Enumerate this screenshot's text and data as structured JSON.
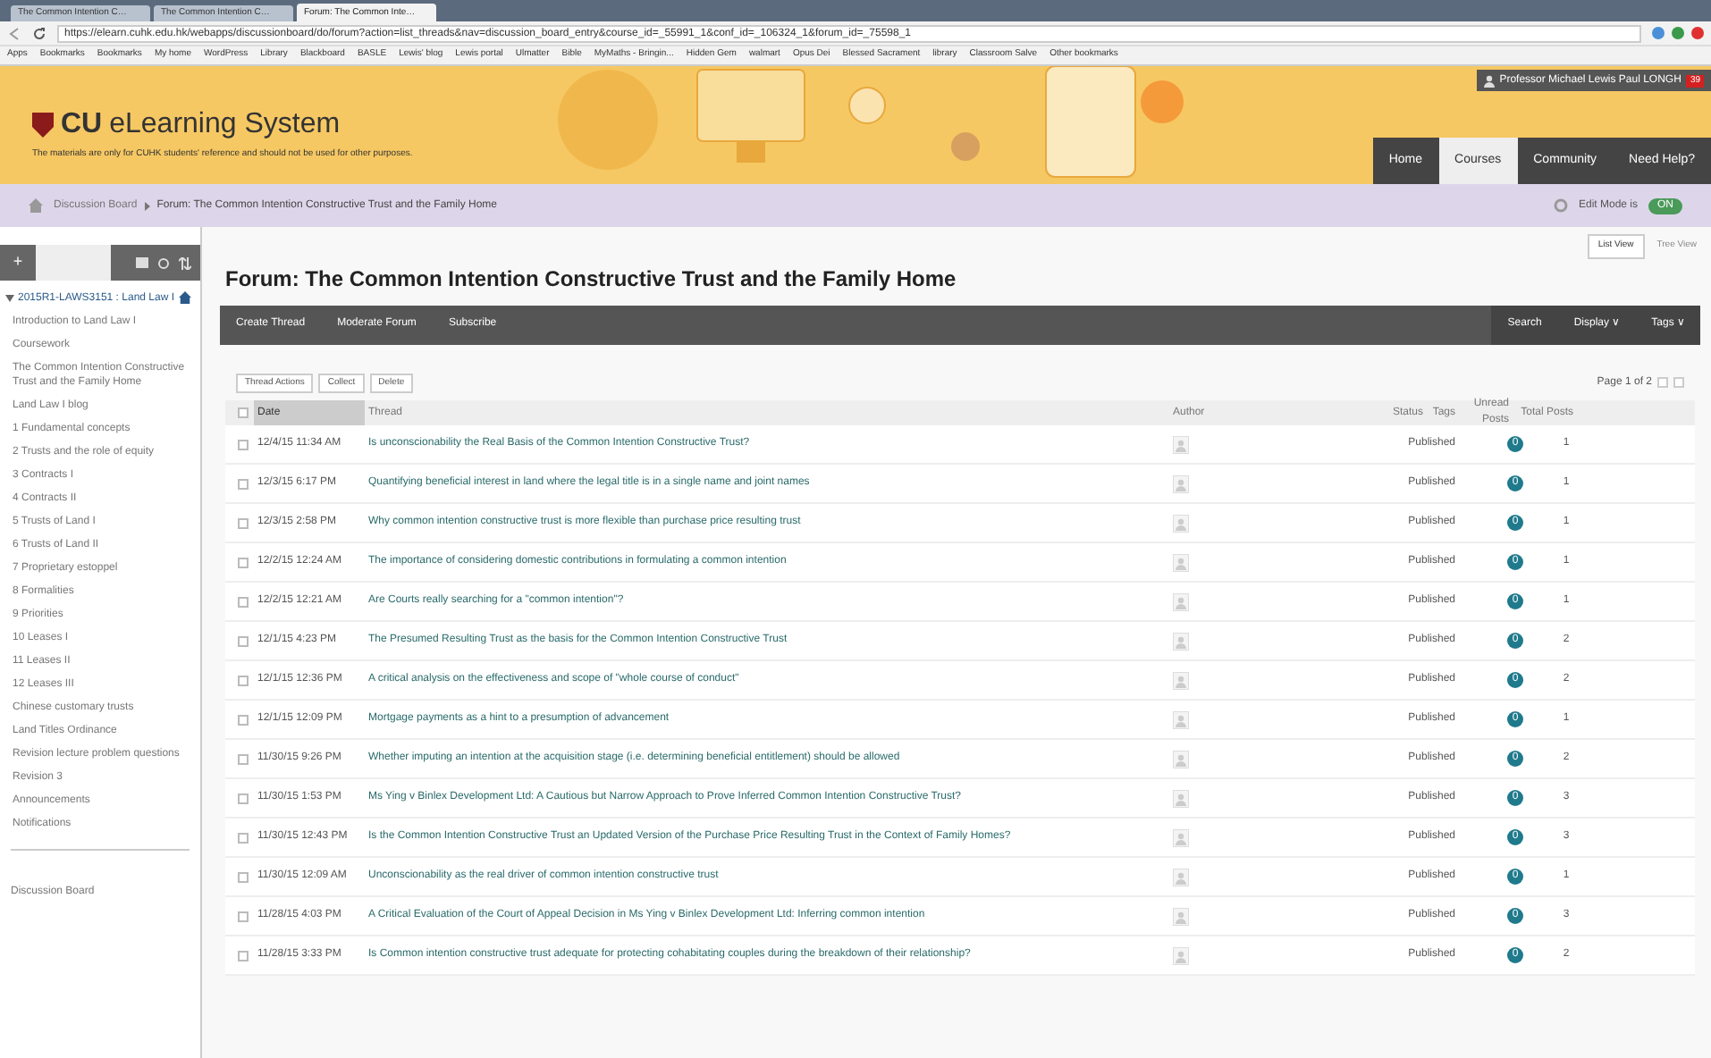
{
  "browser": {
    "tabs": [
      {
        "title": "The Common Intention C…",
        "selected": false
      },
      {
        "title": "The Common Intention C…",
        "selected": false
      },
      {
        "title": "Forum: The Common Inte…",
        "selected": true
      }
    ],
    "url": "https://elearn.cuhk.edu.hk/webapps/discussionboard/do/forum?action=list_threads&nav=discussion_board_entry&course_id=_55991_1&conf_id=_106324_1&forum_id=_75598_1",
    "bookmarks": [
      "Apps",
      "Bookmarks",
      "Bookmarks",
      "My home",
      "WordPress",
      "Library",
      "Blackboard",
      "BASLE",
      "Lewis' blog",
      "Lewis portal",
      "Ulmatter",
      "Bible",
      "MyMaths - Bringin...",
      "Hidden Gem",
      "walmart",
      "Opus Dei",
      "Blessed Sacrament",
      "library",
      "Classroom Salve",
      "Other bookmarks"
    ]
  },
  "header": {
    "logo_mark": "CU",
    "logo_title": "eLearning System",
    "notice": "The materials are only for CUHK students' reference and should not be used for other purposes.",
    "user_name": "Professor Michael Lewis Paul LONGH",
    "notification_count": "39",
    "nav": [
      {
        "label": "Home",
        "selected": false
      },
      {
        "label": "Courses",
        "selected": true
      },
      {
        "label": "Community",
        "selected": false
      },
      {
        "label": "Need Help?",
        "selected": false
      }
    ]
  },
  "breadcrumb": [
    "Discussion Board",
    "Forum: The Common Intention Constructive Trust and the Family Home"
  ],
  "edit_mode": {
    "label": "Edit Mode is",
    "on": true,
    "state_text": "ON"
  },
  "sidebar": {
    "add_button": "+",
    "course": "2015R1-LAWS3151 : Land Law I",
    "items": [
      "Introduction to Land Law I",
      "Coursework",
      "The Common Intention Constructive Trust and the Family Home",
      "Land Law I blog",
      "1 Fundamental concepts",
      "2 Trusts and the role of equity",
      "3 Contracts I",
      "4 Contracts II",
      "5 Trusts of Land I",
      "6 Trusts of Land II",
      "7 Proprietary estoppel",
      "8 Formalities",
      "9 Priorities",
      "10 Leases I",
      "11 Leases II",
      "12 Leases III",
      "Chinese customary trusts",
      "Land Titles Ordinance",
      "Revision lecture problem questions",
      "Revision 3",
      "Announcements",
      "Notifications"
    ],
    "footer_item": "Discussion Board"
  },
  "forum": {
    "view_tabs": [
      {
        "label": "List View",
        "selected": true
      },
      {
        "label": "Tree View",
        "selected": false
      }
    ],
    "title": "Forum: The Common Intention Constructive Trust and the Family Home",
    "actions": [
      "Create Thread",
      "Moderate Forum",
      "Subscribe"
    ],
    "right_actions": [
      "Search",
      "Display ∨",
      "Tags ∨"
    ],
    "thread_actions": [
      "Thread Actions",
      "Collect",
      "Delete"
    ],
    "page": "Page 1 of 2",
    "select_all_checked": false,
    "columns": [
      "Date",
      "Thread",
      "Author",
      "Status",
      "Tags",
      "Unread Posts",
      "Total Posts"
    ],
    "rows": [
      {
        "date": "12/4/15 11:34 AM",
        "thread": "Is unconscionability the Real Basis of the Common Intention Constructive Trust?",
        "status": "Published",
        "unread": "0",
        "total": "1",
        "checked": false
      },
      {
        "date": "12/3/15 6:17 PM",
        "thread": "Quantifying beneficial interest in land where the legal title is in a single name and joint names",
        "status": "Published",
        "unread": "0",
        "total": "1",
        "checked": false
      },
      {
        "date": "12/3/15 2:58 PM",
        "thread": "Why common intention constructive trust is more flexible than purchase price resulting trust",
        "status": "Published",
        "unread": "0",
        "total": "1",
        "checked": false
      },
      {
        "date": "12/2/15 12:24 AM",
        "thread": "The importance of considering domestic contributions in formulating a common intention",
        "status": "Published",
        "unread": "0",
        "total": "1",
        "checked": false
      },
      {
        "date": "12/2/15 12:21 AM",
        "thread": "Are Courts really searching for a \"common intention\"?",
        "status": "Published",
        "unread": "0",
        "total": "1",
        "checked": false
      },
      {
        "date": "12/1/15 4:23 PM",
        "thread": "The Presumed Resulting Trust as the basis for the Common Intention Constructive Trust",
        "status": "Published",
        "unread": "0",
        "total": "2",
        "checked": false
      },
      {
        "date": "12/1/15 12:36 PM",
        "thread": "A critical analysis on the effectiveness and scope of \"whole course of conduct\"",
        "status": "Published",
        "unread": "0",
        "total": "2",
        "checked": false
      },
      {
        "date": "12/1/15 12:09 PM",
        "thread": "Mortgage payments as a hint to a presumption of advancement",
        "status": "Published",
        "unread": "0",
        "total": "1",
        "checked": false
      },
      {
        "date": "11/30/15 9:26 PM",
        "thread": "Whether imputing an intention at the acquisition stage (i.e. determining beneficial entitlement) should be allowed",
        "status": "Published",
        "unread": "0",
        "total": "2",
        "checked": false
      },
      {
        "date": "11/30/15 1:53 PM",
        "thread": "Ms Ying v Binlex Development Ltd: A Cautious but Narrow Approach to Prove Inferred Common Intention Constructive Trust?",
        "status": "Published",
        "unread": "0",
        "total": "3",
        "checked": false
      },
      {
        "date": "11/30/15 12:43 PM",
        "thread": "Is the Common Intention Constructive Trust an Updated Version of the Purchase Price Resulting Trust in the Context of Family Homes?",
        "status": "Published",
        "unread": "0",
        "total": "3",
        "checked": false
      },
      {
        "date": "11/30/15 12:09 AM",
        "thread": "Unconscionability as the real driver of common intention constructive trust",
        "status": "Published",
        "unread": "0",
        "total": "1",
        "checked": false
      },
      {
        "date": "11/28/15 4:03 PM",
        "thread": "A Critical Evaluation of the Court of Appeal Decision in Ms Ying v Binlex Development Ltd: Inferring common intention",
        "status": "Published",
        "unread": "0",
        "total": "3",
        "checked": false
      },
      {
        "date": "11/28/15 3:33 PM",
        "thread": "Is Common intention constructive trust adequate for protecting cohabitating couples during the breakdown of their relationship?",
        "status": "Published",
        "unread": "0",
        "total": "2",
        "checked": false
      }
    ]
  }
}
